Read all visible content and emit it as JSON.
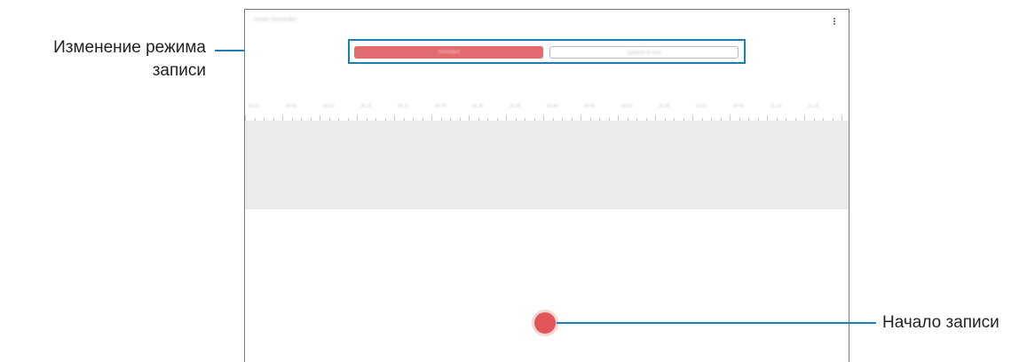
{
  "app": {
    "title": "Voice Recorder",
    "menu_icon": "more-vertical-icon"
  },
  "modes": {
    "standard": "Standard",
    "second": "Speech-to-text",
    "selected": "standard"
  },
  "timeline": {
    "labels": [
      "00:00",
      "00:05",
      "00:10",
      "00:15",
      "00:20",
      "00:25",
      "00:30",
      "00:35",
      "00:40",
      "00:45",
      "00:50",
      "00:55",
      "01:00",
      "01:05",
      "01:10",
      "01:15"
    ]
  },
  "record": {
    "icon": "record-icon"
  },
  "callouts": {
    "mode_change_line1": "Изменение режима",
    "mode_change_line2": "записи",
    "start_recording": "Начало записи"
  },
  "colors": {
    "accent_blue": "#1a7fb5",
    "record_red": "#e25558",
    "mode_selected": "#e16b6f"
  }
}
